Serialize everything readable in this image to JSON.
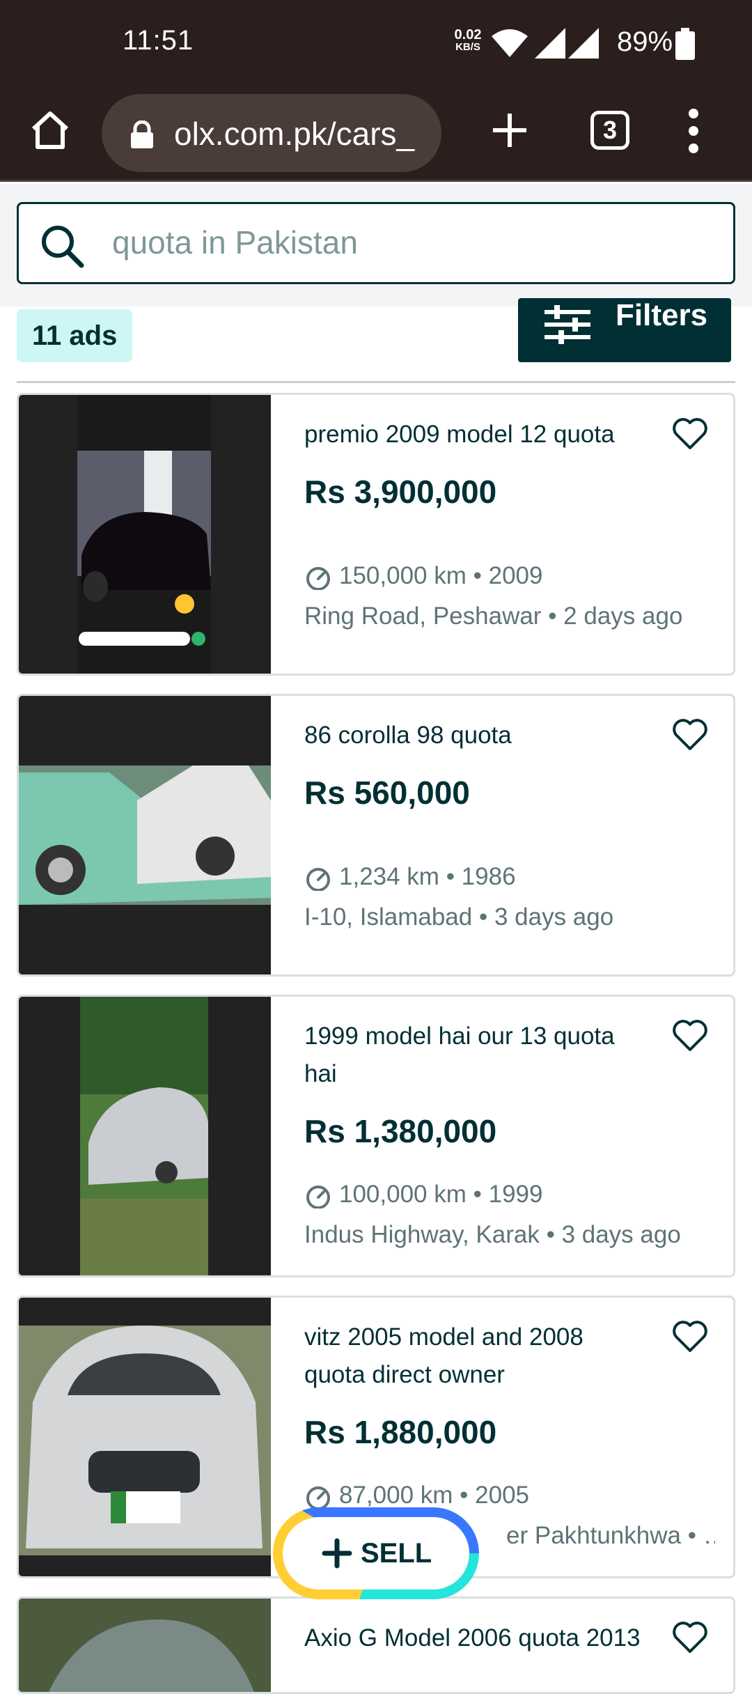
{
  "status_bar": {
    "time": "11:51",
    "net_speed": "0.02",
    "net_unit": "KB/S",
    "battery": "89%"
  },
  "browser": {
    "url": "olx.com.pk/cars_",
    "tab_count": "3"
  },
  "search": {
    "value": "quota in Pakistan"
  },
  "results": {
    "count_label": "11 ads",
    "filters_label": "Filters"
  },
  "listings": [
    {
      "title": "premio 2009 model 12 quota",
      "price": "Rs 3,900,000",
      "km": "150,000 km",
      "year": "2009",
      "location": "Ring Road, Peshawar",
      "age": "2 days ago"
    },
    {
      "title": "86 corolla 98 quota",
      "price": "Rs 560,000",
      "km": "1,234 km",
      "year": "1986",
      "location": "I-10, Islamabad",
      "age": "3 days ago"
    },
    {
      "title": "1999 model hai our 13 quota hai",
      "price": "Rs 1,380,000",
      "km": "100,000 km",
      "year": "1999",
      "location": "Indus Highway, Karak",
      "age": "3 days ago"
    },
    {
      "title": "vitz 2005 model and 2008 quota direct owner",
      "price": "Rs 1,880,000",
      "km": "87,000 km",
      "year": "2005",
      "location": "er Pakhtunkhwa",
      "age": "…"
    },
    {
      "title": "Axio G Model 2006 quota 2013"
    }
  ],
  "sell_button": {
    "label": "SELL"
  },
  "colors": {
    "brand_dark": "#002f34",
    "badge_bg": "#cdf6f4",
    "status_bar": "#2b1f1d"
  }
}
